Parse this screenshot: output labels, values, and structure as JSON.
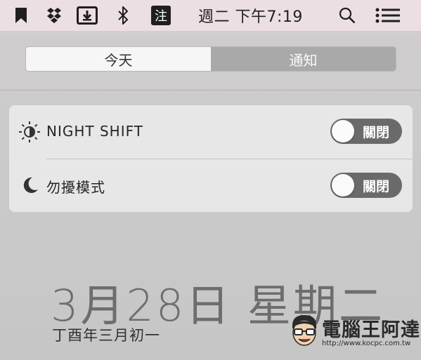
{
  "menubar": {
    "clock": "週二 下午7:19",
    "icons": [
      "bookmark-icon",
      "dropbox-icon",
      "download-icon",
      "bluetooth-icon",
      "input-method-icon",
      "search-icon",
      "notification-center-icon"
    ],
    "input_method_char": "注"
  },
  "tabs": {
    "today": "今天",
    "notifications": "通知",
    "selected": "今天"
  },
  "toggles": [
    {
      "label": "NIGHT SHIFT",
      "state": "關閉",
      "icon": "night-shift-icon"
    },
    {
      "label": "勿擾模式",
      "state": "關閉",
      "icon": "moon-icon"
    }
  ],
  "date": {
    "main": "3月28日 星期二",
    "lunar": "丁酉年三月初一"
  },
  "watermark": {
    "name": "電腦王阿達",
    "url": "http://www.kocpc.com.tw"
  },
  "colors": {
    "menubar_bg": "#ecdfe3",
    "toggle_off": "#6a6a6a",
    "tab_inactive": "#a9a9a9"
  }
}
